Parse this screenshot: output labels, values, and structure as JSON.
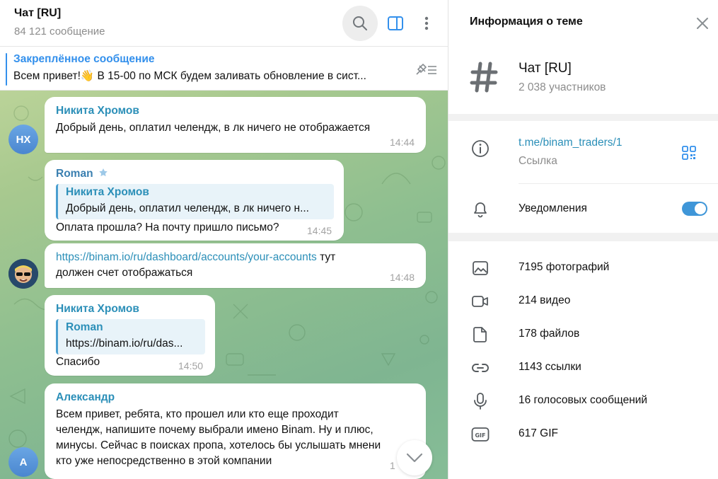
{
  "chat": {
    "title": "Чат [RU]",
    "subtitle": "84 121 сообщение"
  },
  "pinned": {
    "title": "Закреплённое сообщение",
    "text": "Всем привет!👋  В 15-00 по МСК будем заливать обновление в сист..."
  },
  "messages": [
    {
      "sender": "Никита Хромов",
      "text": "Добрый день, оплатил челендж, в лк ничего не отображается",
      "time": "14:44",
      "avatar_initials": "НХ"
    },
    {
      "sender": "Roman",
      "reply_name": "Никита Хромов",
      "reply_text": "Добрый день, оплатил челендж, в лк ничего н...",
      "text": "Оплата прошла? На почту пришло письмо?",
      "time": "14:45"
    },
    {
      "link": "https://binam.io/ru/dashboard/accounts/your-accounts",
      "text_after_link": " тут",
      "text_line2": "должен счет отображаться",
      "time": "14:48"
    },
    {
      "sender": "Никита Хромов",
      "reply_name": "Roman",
      "reply_text": "https://binam.io/ru/das...",
      "text": "Спасибо",
      "time": "14:50",
      "avatar_initials": "НХ"
    },
    {
      "sender": "Александр",
      "lines": [
        "Всем привет, ребята, кто прошел или кто еще проходит",
        "челендж, напишите почему выбрали имено Binam. Ну и плюс,",
        "минусы. Сейчас в поисках пропа, хотелось бы услышать мнени",
        "кто уже непосредственно в этой компании"
      ],
      "time": "1",
      "avatar_initials": "А"
    }
  ],
  "info_panel": {
    "title": "Информация о теме",
    "topic_name": "Чат [RU]",
    "members": "2 038 участников",
    "link": "t.me/binam_traders/1",
    "link_caption": "Ссылка",
    "notifications_label": "Уведомления",
    "notifications_on": true,
    "media": [
      {
        "icon": "photo-icon",
        "label": "7195 фотографий"
      },
      {
        "icon": "video-icon",
        "label": "214 видео"
      },
      {
        "icon": "file-icon",
        "label": "178 файлов"
      },
      {
        "icon": "link-icon",
        "label": "1143 ссылки"
      },
      {
        "icon": "microphone-icon",
        "label": "16 голосовых сообщений"
      },
      {
        "icon": "gif-icon",
        "label": "617 GIF"
      }
    ]
  },
  "colors": {
    "accent": "#3390ec",
    "sender": "#2b8fb8",
    "toggle": "#3f96d8"
  }
}
